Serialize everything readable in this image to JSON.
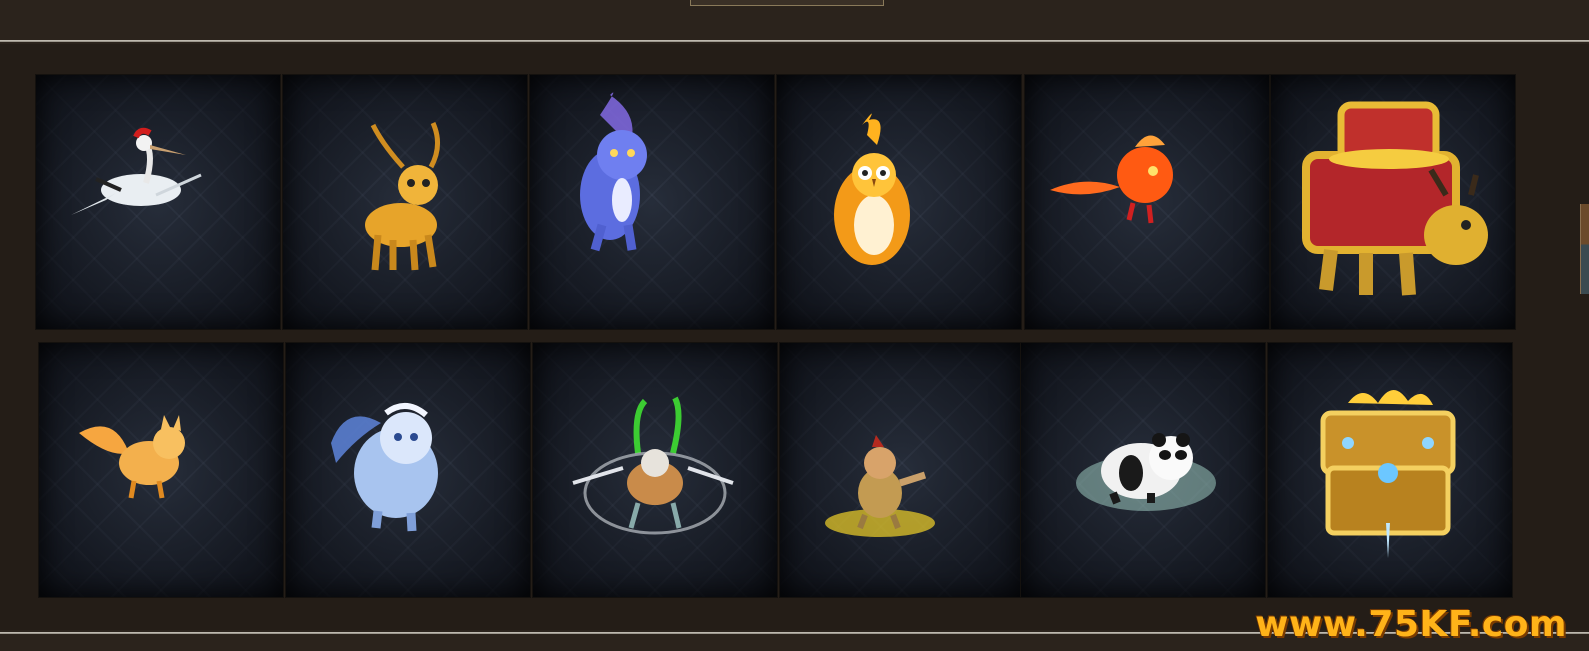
{
  "watermark": {
    "text": "www.75KF.com"
  },
  "pets": [
    {
      "icon": "crane-pet-icon"
    },
    {
      "icon": "golden-deer-pet-icon"
    },
    {
      "icon": "blue-flame-wolf-pet-icon"
    },
    {
      "icon": "fire-owl-pet-icon"
    },
    {
      "icon": "fire-phoenix-pet-icon"
    },
    {
      "icon": "treasure-turtle-pet-icon"
    },
    {
      "icon": "golden-fox-pet-icon"
    },
    {
      "icon": "ice-beast-pet-icon"
    },
    {
      "icon": "mantis-mount-pet-icon"
    },
    {
      "icon": "monkey-warrior-pet-icon"
    },
    {
      "icon": "panda-pet-icon"
    },
    {
      "icon": "golden-treasure-chest-icon"
    }
  ],
  "colors": {
    "background": "#2b231c",
    "tile": "#1b2029",
    "watermark": "#ffb319"
  }
}
